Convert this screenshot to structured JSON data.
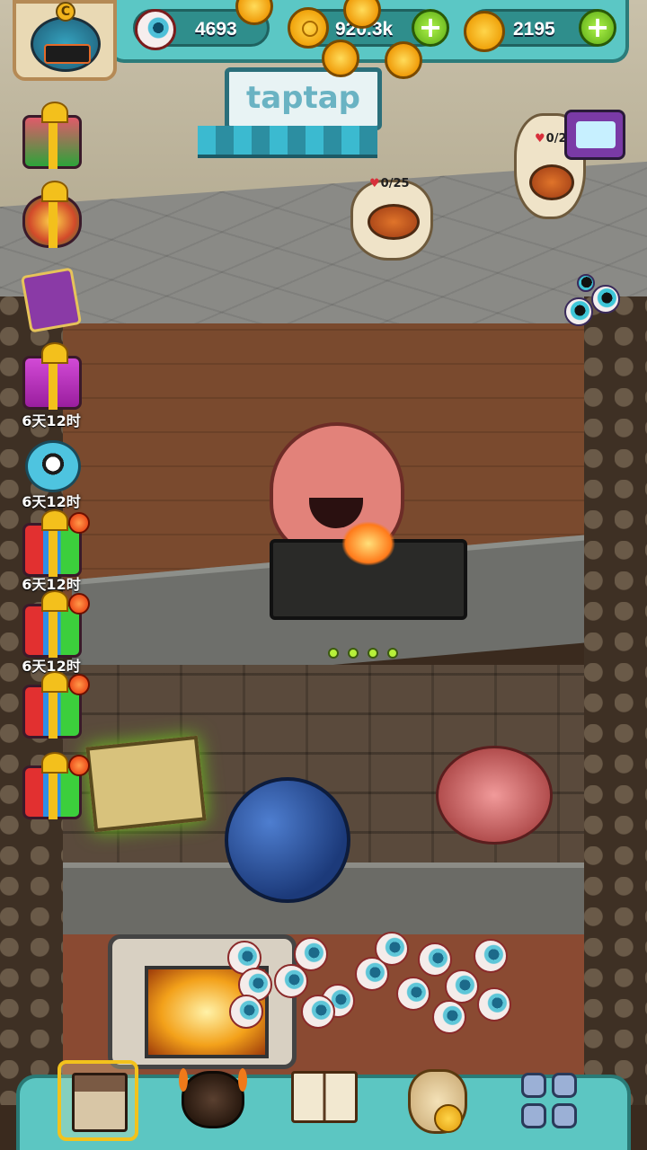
{
  "resources": {
    "eyeballs": {
      "value": "4693",
      "icon": "eyeball-icon"
    },
    "coins": {
      "value": "920.3k",
      "icon": "coin-icon"
    },
    "premium": {
      "value": "2195",
      "icon": "coin-sack-icon"
    }
  },
  "player": {
    "badge": "C"
  },
  "scene": {
    "shop_sign": "taptap",
    "order_bubble_1": {
      "hearts": "0/25"
    },
    "order_bubble_2": {
      "hearts": "0/2"
    }
  },
  "events": [
    {
      "icon": "purple-gift-icon",
      "timer": "6天12时"
    },
    {
      "icon": "cyan-monster-icon",
      "timer": "6天12时"
    },
    {
      "icon": "rainbow-gift-icon",
      "timer": "6天12时"
    },
    {
      "icon": "rainbow-gift-icon",
      "timer": "6天12时"
    },
    {
      "icon": "rainbow-gift-icon",
      "timer": ""
    },
    {
      "icon": "rainbow-gift-icon",
      "timer": ""
    }
  ],
  "bottom_nav": [
    {
      "name": "shop",
      "icon": "shop-icon",
      "active": true
    },
    {
      "name": "monster",
      "icon": "monster-icon",
      "active": false
    },
    {
      "name": "book",
      "icon": "book-icon",
      "active": false
    },
    {
      "name": "bag",
      "icon": "coin-bag-icon",
      "active": false
    },
    {
      "name": "menu",
      "icon": "grid-menu-icon",
      "active": false
    }
  ],
  "colors": {
    "bar_teal": "#5bc7c5",
    "plus_green": "#7dd22c",
    "coin_gold": "#f5b81c"
  }
}
